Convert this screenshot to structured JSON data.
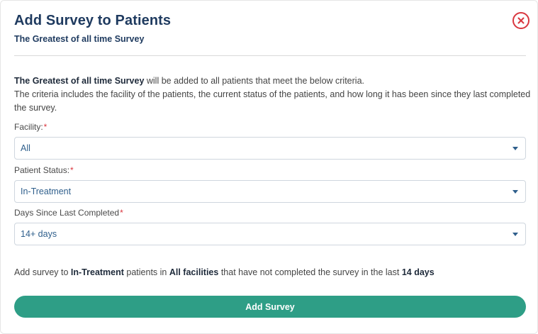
{
  "dialog": {
    "title": "Add Survey to Patients",
    "subtitle": "The Greatest of all time Survey"
  },
  "intro": {
    "survey_name": "The Greatest of all time Survey",
    "line1_rest": " will be added to all patients that meet the below criteria.",
    "line2": "The criteria includes the facility of the patients, the current status of the patients, and how long it has been since they last completed the survey."
  },
  "fields": {
    "facility": {
      "label": "Facility:",
      "required_mark": "*",
      "value": "All"
    },
    "patient_status": {
      "label": "Patient Status:",
      "required_mark": "*",
      "value": "In-Treatment"
    },
    "days_since": {
      "label": "Days Since Last Completed",
      "required_mark": "*",
      "value": "14+ days"
    }
  },
  "summary": {
    "prefix": "Add survey to ",
    "status": "In-Treatment",
    "mid1": " patients in ",
    "facilities": "All facilities",
    "mid2": " that have not completed the survey in the last ",
    "days": "14 days"
  },
  "actions": {
    "submit_label": "Add Survey"
  },
  "icons": {
    "close": "close-circle-icon",
    "dropdown": "caret-down-icon"
  },
  "colors": {
    "title": "#1e3a5f",
    "accent": "#2e9e86",
    "danger": "#d9363e",
    "select_text": "#2f5f8c"
  }
}
